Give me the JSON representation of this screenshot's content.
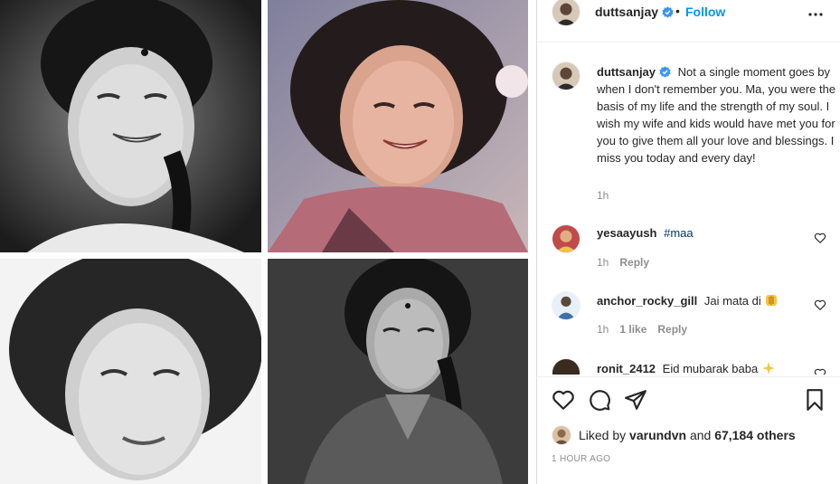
{
  "post": {
    "username": "duttsanjay",
    "separator": "•",
    "follow_label": "Follow",
    "more_icon": "more-options-icon"
  },
  "caption": {
    "username": "duttsanjay",
    "text": "Not a single moment goes by when I don't remember you. Ma, you were the basis of my life and the strength of my soul. I wish my wife and kids would have met you for you to give them all your love and blessings. I miss you today and every day!",
    "time": "1h"
  },
  "comments": [
    {
      "username": "yesaayush",
      "text": "#maa",
      "time": "1h",
      "likes": "",
      "reply": "Reply"
    },
    {
      "username": "anchor_rocky_gill",
      "text": "Jai mata di",
      "time": "1h",
      "likes": "1 like",
      "reply": "Reply"
    },
    {
      "username": "ronit_2412",
      "text": "Eid mubarak baba"
    }
  ],
  "likes": {
    "prefix": "Liked by",
    "user": "varundvn",
    "conjunction": "and",
    "others": "67,184 others"
  },
  "timestamp": "1 HOUR AGO",
  "icons": {
    "like": "heart-icon",
    "comment": "comment-icon",
    "share": "share-icon",
    "save": "bookmark-icon"
  },
  "colors": {
    "accent": "#0095f6",
    "verified": "#3897f0",
    "muted": "#8e8e8e",
    "hashtag": "#00376b"
  }
}
